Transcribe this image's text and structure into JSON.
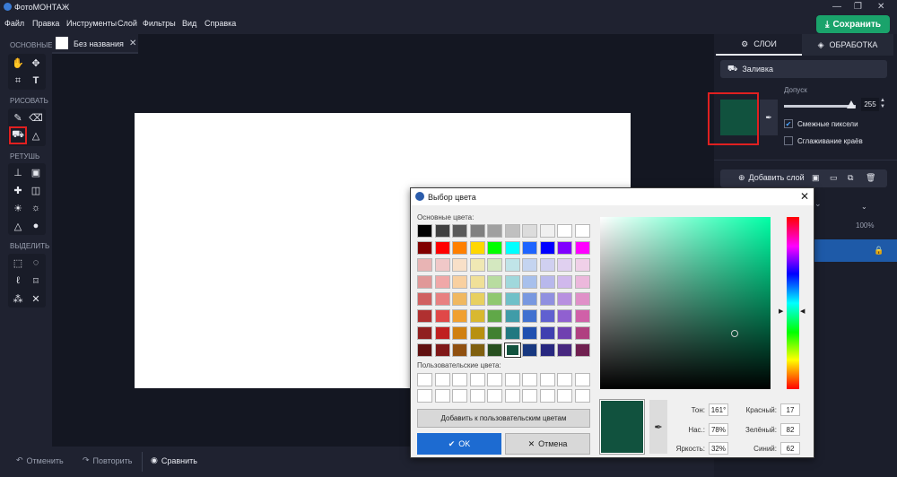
{
  "app": {
    "title": "ФотоМОНТАЖ"
  },
  "menu": [
    "Файл",
    "Правка",
    "Инструменты",
    "Слой",
    "Фильтры",
    "Вид",
    "Справка"
  ],
  "save_button": "Сохранить",
  "toolbar": {
    "sections": {
      "basic": "ОСНОВНЫЕ",
      "draw": "РИСОВАТЬ",
      "retouch": "РЕТУШЬ",
      "select": "ВЫДЕЛИТЬ"
    }
  },
  "document": {
    "tab_name": "Без названия"
  },
  "bottom": {
    "undo": "Отменить",
    "redo": "Повторить",
    "compare": "Сравнить"
  },
  "right_panel": {
    "tabs": [
      "СЛОИ",
      "ОБРАБОТКА"
    ],
    "fill_button": "Заливка",
    "fill_color": "#11523e",
    "tolerance": {
      "label": "Допуск",
      "value": "255"
    },
    "contiguous": {
      "label": "Смежные пиксели",
      "checked": true
    },
    "antialias": {
      "label": "Сглаживание краёв",
      "checked": false
    },
    "add_layer": "Добавить слой",
    "opacity": "100%"
  },
  "dialog": {
    "title": "Выбор цвета",
    "basic_colors_label": "Основные цвета:",
    "custom_colors_label": "Пользовательские цвета:",
    "add_custom_button": "Добавить к пользовательским цветам",
    "ok_button": "OK",
    "cancel_button": "Отмена",
    "fields": {
      "hue": {
        "label": "Тон:",
        "value": "161°"
      },
      "sat": {
        "label": "Нас.:",
        "value": "78%"
      },
      "bright": {
        "label": "Яркость:",
        "value": "32%"
      },
      "red": {
        "label": "Красный:",
        "value": "17"
      },
      "green": {
        "label": "Зелёный:",
        "value": "82"
      },
      "blue": {
        "label": "Синий:",
        "value": "62"
      }
    },
    "basic_colors": [
      [
        "#000000",
        "#404040",
        "#5a5a5a",
        "#808080",
        "#a0a0a0",
        "#c0c0c0",
        "#dcdcdc",
        "#f0f0f0",
        "#ffffff",
        "#ffffff"
      ],
      [
        "#800000",
        "#ff0000",
        "#ff8000",
        "#ffd700",
        "#00ff00",
        "#00ffff",
        "#1e64ff",
        "#0000ff",
        "#8000ff",
        "#ff00ff"
      ],
      [
        "#e8b4b4",
        "#f0c8c8",
        "#f8e0c8",
        "#f0e8b4",
        "#d4e8c0",
        "#c0e4e8",
        "#c4d4f0",
        "#d0d0f0",
        "#e0d0f0",
        "#f0d0e8"
      ],
      [
        "#e09898",
        "#f0a8a8",
        "#f8d0a0",
        "#f0e098",
        "#b8dca0",
        "#a0d8dc",
        "#a8c0ec",
        "#b8b8ec",
        "#d0b8ec",
        "#ecb8dc"
      ],
      [
        "#d06060",
        "#e88080",
        "#f0b860",
        "#e8d060",
        "#90c870",
        "#70c0c8",
        "#7898e0",
        "#9090e0",
        "#b890e0",
        "#e090c8"
      ],
      [
        "#b03030",
        "#e04848",
        "#f0a030",
        "#d8b830",
        "#60a848",
        "#409ca8",
        "#4070d0",
        "#6060d0",
        "#9060d0",
        "#d060a8"
      ],
      [
        "#902020",
        "#c02020",
        "#d08010",
        "#b89010",
        "#408030",
        "#207880",
        "#2050b0",
        "#4040b0",
        "#7040b0",
        "#b04080"
      ],
      [
        "#601010",
        "#801818",
        "#905010",
        "#806010",
        "#285020",
        "#11523e",
        "#183880",
        "#282880",
        "#482880",
        "#702050"
      ]
    ],
    "selected_basic": {
      "row": 7,
      "col": 5
    }
  }
}
